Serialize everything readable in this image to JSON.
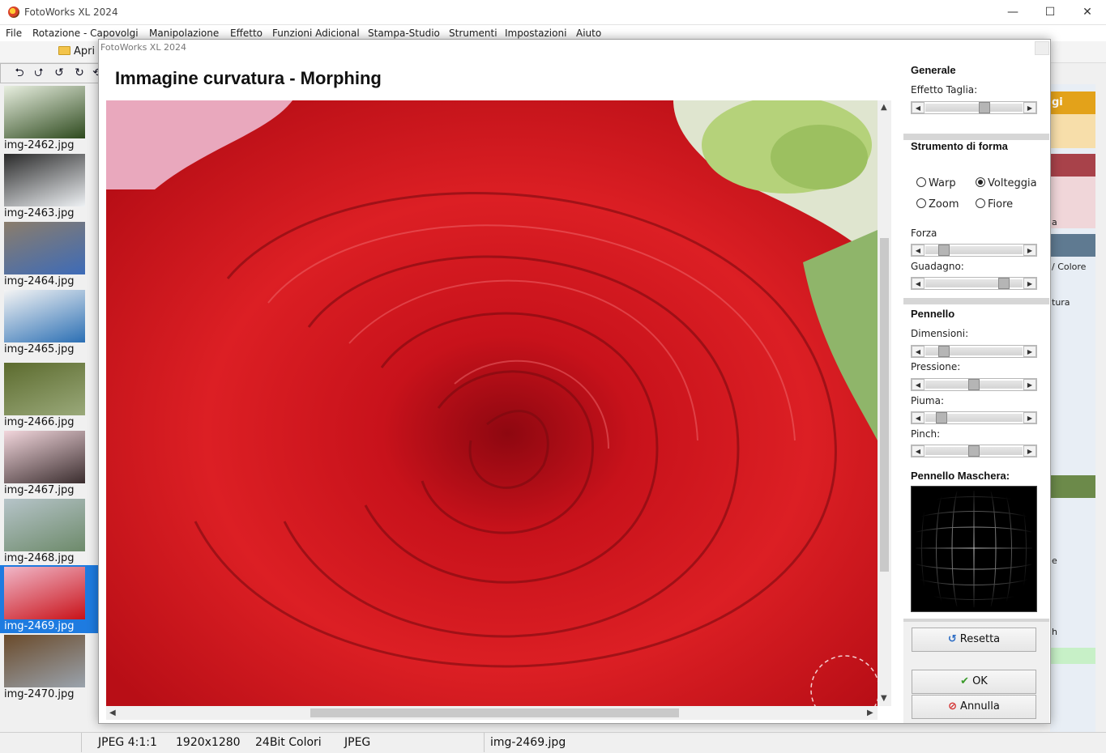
{
  "app": {
    "title": "FotoWorks XL 2024"
  },
  "window_controls": {
    "minimize": "—",
    "maximize": "☐",
    "close": "✕"
  },
  "menu": [
    "File",
    "Rotazione - Capovolgi",
    "Manipolazione",
    "Effetto",
    "Funzioni Adicional",
    "Stampa-Studio",
    "Strumenti",
    "Impostazioni",
    "Aiuto"
  ],
  "toolbar": {
    "open_label": "Apri f"
  },
  "thumbnails": [
    {
      "name": "img-2462.jpg",
      "colors": [
        "#2e4a1e",
        "#e8efe0"
      ]
    },
    {
      "name": "img-2463.jpg",
      "colors": [
        "#eef1f4",
        "#2a2a2a"
      ]
    },
    {
      "name": "img-2464.jpg",
      "colors": [
        "#3d6bb8",
        "#8b7d6b"
      ]
    },
    {
      "name": "img-2465.jpg",
      "colors": [
        "#2b6fb4",
        "#f4f4f4"
      ]
    },
    {
      "name": "img-2466.jpg",
      "colors": [
        "#9aa97a",
        "#5c6b2e"
      ]
    },
    {
      "name": "img-2467.jpg",
      "colors": [
        "#3a2d2e",
        "#f2d6dc"
      ]
    },
    {
      "name": "img-2468.jpg",
      "colors": [
        "#6d8a6a",
        "#b6c4c9"
      ]
    },
    {
      "name": "img-2469.jpg",
      "colors": [
        "#c91219",
        "#f0b7c8"
      ],
      "selected": true
    },
    {
      "name": "img-2470.jpg",
      "colors": [
        "#9aa3ad",
        "#6a4a2a"
      ]
    }
  ],
  "right_panel": {
    "header_text": "gi",
    "colore": "/ Colore",
    "tura": "tura",
    "a": "a",
    "e": "e",
    "h": "h",
    "colors": {
      "orange": "#e3a21a",
      "light_orange": "#f7deaa",
      "maroon": "#a8424a",
      "pink": "#f0d6d9",
      "steel": "#5f7a91",
      "green": "#6c8a4a",
      "light_green": "#c7f0c7"
    }
  },
  "status": {
    "format": "JPEG  4:1:1",
    "size": "1920x1280",
    "depth": "24Bit Colori",
    "type": "JPEG",
    "file": "img-2469.jpg"
  },
  "dialog": {
    "title": "FotoWorks XL 2024",
    "heading": "Immagine curvatura - Morphing",
    "generale": {
      "title": "Generale",
      "effetto_taglia_label": "Effetto Taglia:",
      "effetto_taglia_value": 0.62
    },
    "strumento": {
      "title": "Strumento di forma",
      "options": [
        {
          "label": "Warp",
          "selected": false
        },
        {
          "label": "Volteggia",
          "selected": true
        },
        {
          "label": "Zoom",
          "selected": false
        },
        {
          "label": "Fiore",
          "selected": false
        }
      ],
      "forza_label": "Forza",
      "forza_value": 0.15,
      "guadagno_label": "Guadagno:",
      "guadagno_value": 0.85
    },
    "pennello": {
      "title": "Pennello",
      "dimensioni_label": "Dimensioni:",
      "dimensioni_value": 0.15,
      "pressione_label": "Pressione:",
      "pressione_value": 0.5,
      "piuma_label": "Piuma:",
      "piuma_value": 0.12,
      "pinch_label": "Pinch:",
      "pinch_value": 0.5
    },
    "maschera": {
      "title": "Pennello Maschera:"
    },
    "buttons": {
      "reset": "Resetta",
      "ok": "OK",
      "cancel": "Annulla"
    },
    "scroll_arrows": {
      "up": "▲",
      "down": "▼",
      "left": "◀",
      "right": "▶"
    },
    "slider_arrows": {
      "left": "◀",
      "right": "▶"
    },
    "icons": {
      "reset": "↺",
      "ok": "✔",
      "cancel": "⊘"
    }
  }
}
